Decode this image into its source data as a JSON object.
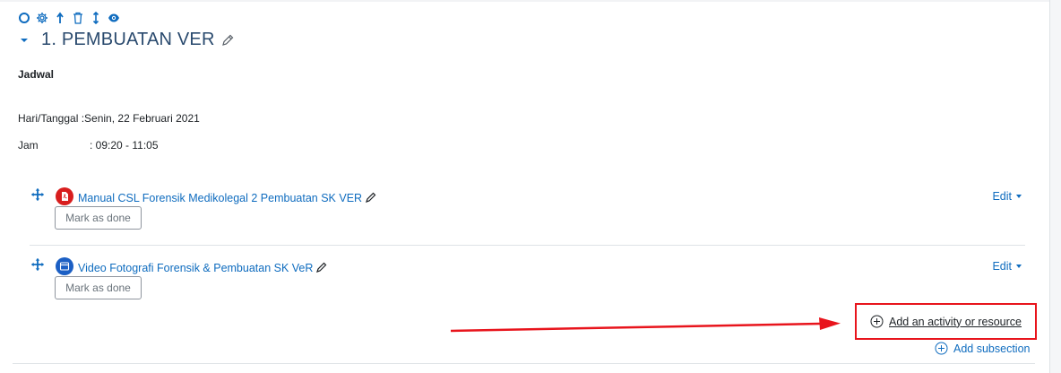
{
  "section": {
    "title": "1. PEMBUATAN VER",
    "toolbar_icons": [
      "highlight-icon",
      "settings-icon",
      "move-up-icon",
      "delete-icon",
      "move-icon",
      "visibility-icon"
    ]
  },
  "summary": {
    "heading": "Jadwal",
    "date_line": "Hari/Tanggal :Senin, 22 Februari 2021",
    "time_label": "Jam",
    "time_value": ": 09:20 - 11:05"
  },
  "activities": [
    {
      "title": "Manual CSL Forensik Medikolegal 2 Pembuatan SK VER",
      "type": "pdf-file-icon",
      "mark_done_label": "Mark as done",
      "edit_label": "Edit",
      "color": "#d81e1e"
    },
    {
      "title": "Video Fotografi Forensik & Pembuatan SK VeR",
      "type": "video-page-icon",
      "mark_done_label": "Mark as done",
      "edit_label": "Edit",
      "color": "#1b5fc4"
    }
  ],
  "actions": {
    "add_activity_label": "Add an activity or resource",
    "add_subsection_label": "Add subsection"
  },
  "colors": {
    "link": "#0f6cbf",
    "title": "#2a4a6e",
    "annotation": "#e8141c"
  }
}
